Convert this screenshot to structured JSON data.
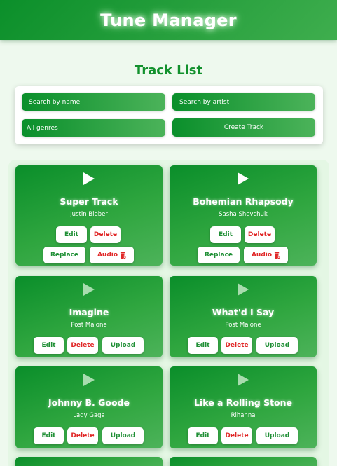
{
  "app": {
    "title": "Tune Manager"
  },
  "page": {
    "title": "Track List"
  },
  "filters": {
    "search_name_placeholder": "Search by name",
    "search_artist_placeholder": "Search by artist",
    "genre_selected": "All genres",
    "create_label": "Create Track"
  },
  "labels": {
    "edit": "Edit",
    "delete": "Delete",
    "replace": "Replace",
    "audio": "Audio",
    "upload": "Upload"
  },
  "colors": {
    "accent": "#12912d",
    "danger": "#e02727",
    "background": "#eef9ee"
  },
  "tracks": [
    {
      "title": "Super Track",
      "artist": "Justin Bieber",
      "has_audio": true
    },
    {
      "title": "Bohemian Rhapsody",
      "artist": "Sasha Shevchuk",
      "has_audio": true
    },
    {
      "title": "Imagine",
      "artist": "Post Malone",
      "has_audio": false
    },
    {
      "title": "What'd I Say",
      "artist": "Post Malone",
      "has_audio": false
    },
    {
      "title": "Johnny B. Goode",
      "artist": "Lady Gaga",
      "has_audio": false
    },
    {
      "title": "Like a Rolling Stone",
      "artist": "Rihanna",
      "has_audio": false
    }
  ]
}
